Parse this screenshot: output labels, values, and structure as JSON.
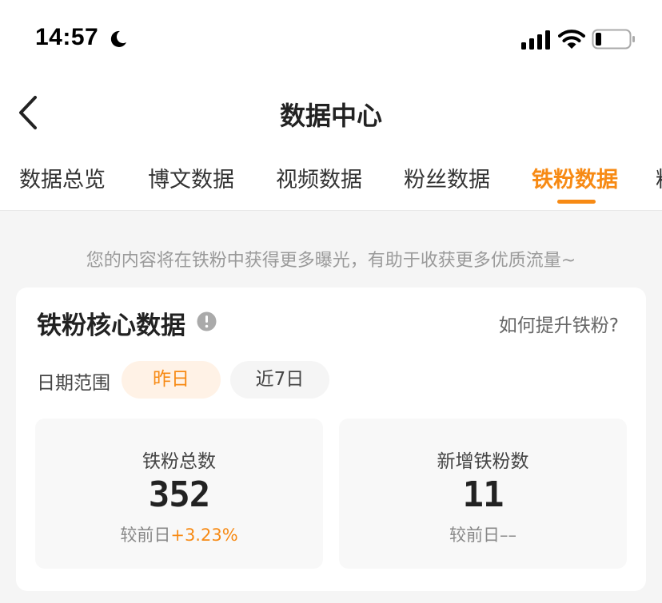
{
  "status_bar": {
    "time": "14:57"
  },
  "nav": {
    "title": "数据中心"
  },
  "tabs": [
    {
      "label": "数据总览"
    },
    {
      "label": "博文数据"
    },
    {
      "label": "视频数据"
    },
    {
      "label": "粉丝数据"
    },
    {
      "label": "铁粉数据",
      "active": true
    },
    {
      "label": "粉"
    }
  ],
  "tip": "您的内容将在铁粉中获得更多曝光，有助于收获更多优质流量~",
  "card": {
    "title": "铁粉核心数据",
    "help_link": "如何提升铁粉?",
    "date_range_label": "日期范围",
    "chips": {
      "yesterday": "昨日",
      "seven_days": "近7日"
    },
    "stats": {
      "total": {
        "label": "铁粉总数",
        "value": "352",
        "compare_label": "较前日",
        "compare_value": "+3.23%"
      },
      "new": {
        "label": "新增铁粉数",
        "value": "11",
        "compare_label": "较前日",
        "compare_value": "––"
      }
    }
  },
  "colors": {
    "accent": "#f78a14",
    "accent_light": "#fff2e6",
    "background": "#f5f5f5"
  }
}
